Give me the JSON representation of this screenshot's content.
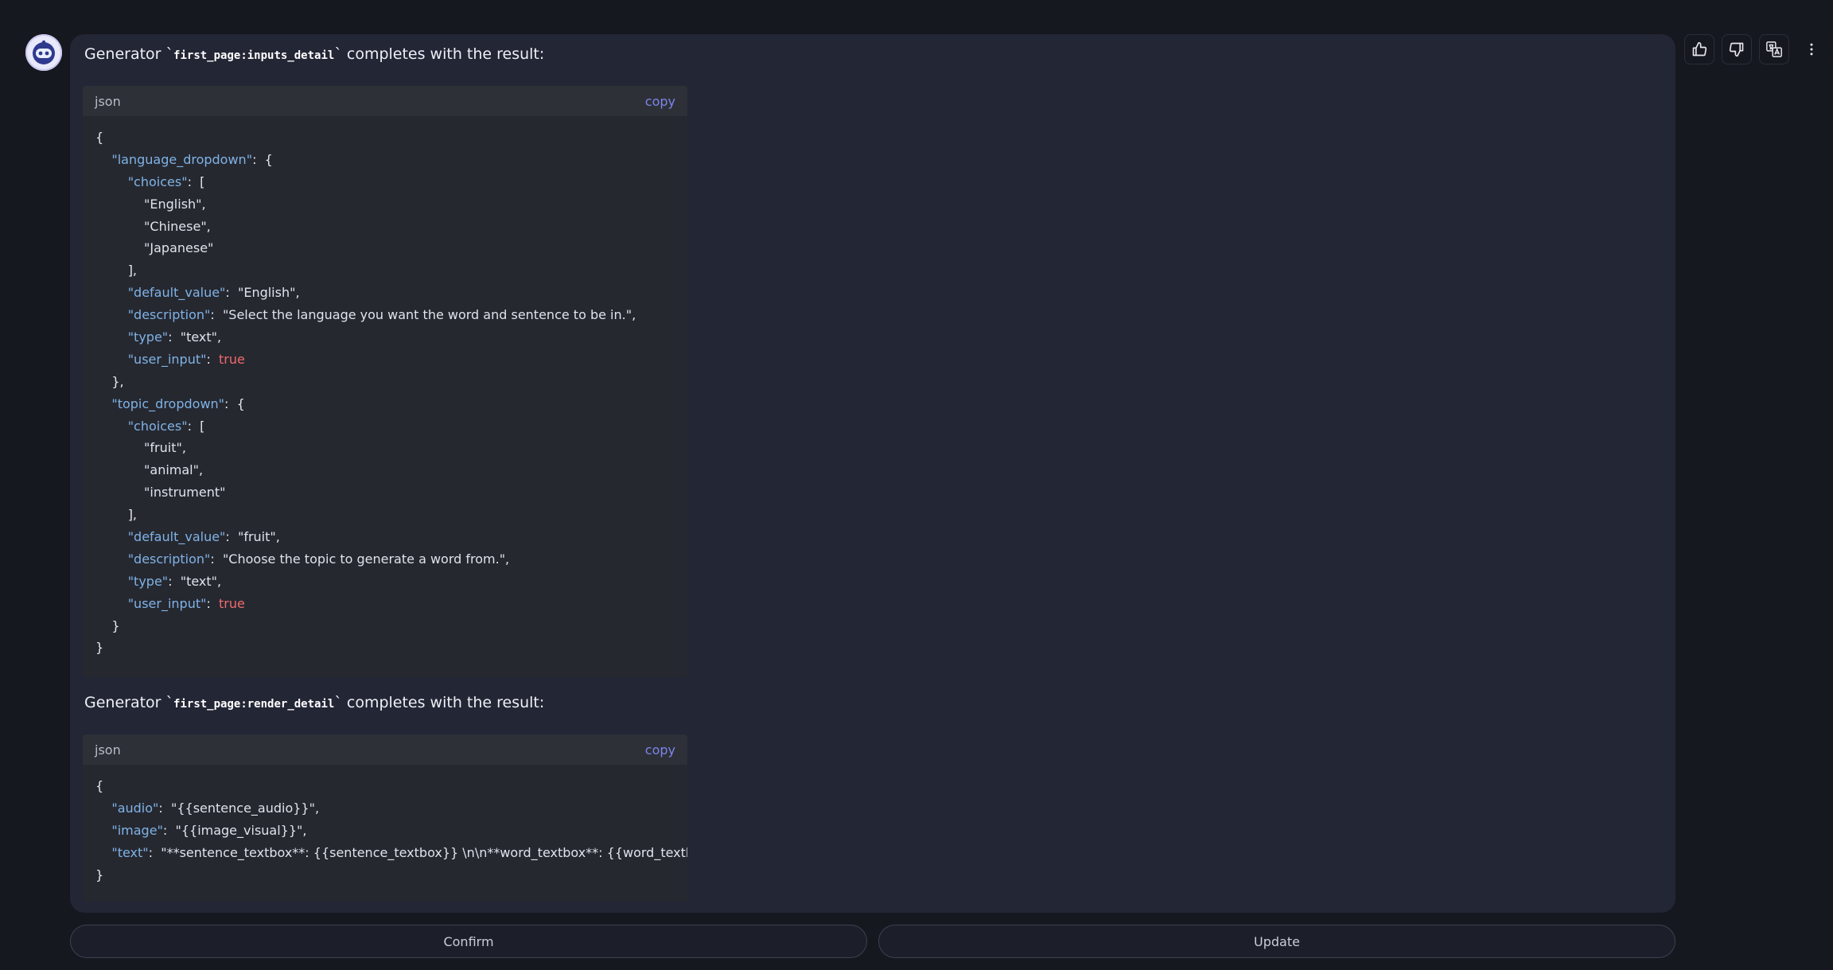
{
  "message_1": {
    "prefix": "Generator `",
    "generator": "first_page:inputs_detail",
    "suffix": "` completes with the result:"
  },
  "code_1": {
    "lang": "json",
    "copy_label": "copy",
    "lines": [
      [
        [
          "p",
          "{"
        ]
      ],
      [
        [
          "p",
          "    "
        ],
        [
          "k",
          "\"language_dropdown\""
        ],
        [
          "p",
          ":  {"
        ]
      ],
      [
        [
          "p",
          "        "
        ],
        [
          "k",
          "\"choices\""
        ],
        [
          "p",
          ":  ["
        ]
      ],
      [
        [
          "p",
          "            "
        ],
        [
          "s",
          "\"English\""
        ],
        [
          "p",
          ","
        ]
      ],
      [
        [
          "p",
          "            "
        ],
        [
          "s",
          "\"Chinese\""
        ],
        [
          "p",
          ","
        ]
      ],
      [
        [
          "p",
          "            "
        ],
        [
          "s",
          "\"Japanese\""
        ]
      ],
      [
        [
          "p",
          "        ],"
        ]
      ],
      [
        [
          "p",
          "        "
        ],
        [
          "k",
          "\"default_value\""
        ],
        [
          "p",
          ":  "
        ],
        [
          "s",
          "\"English\""
        ],
        [
          "p",
          ","
        ]
      ],
      [
        [
          "p",
          "        "
        ],
        [
          "k",
          "\"description\""
        ],
        [
          "p",
          ":  "
        ],
        [
          "s",
          "\"Select the language you want the word and sentence to be in.\""
        ],
        [
          "p",
          ","
        ]
      ],
      [
        [
          "p",
          "        "
        ],
        [
          "k",
          "\"type\""
        ],
        [
          "p",
          ":  "
        ],
        [
          "s",
          "\"text\""
        ],
        [
          "p",
          ","
        ]
      ],
      [
        [
          "p",
          "        "
        ],
        [
          "k",
          "\"user_input\""
        ],
        [
          "p",
          ":  "
        ],
        [
          "b",
          "true"
        ]
      ],
      [
        [
          "p",
          "    },"
        ]
      ],
      [
        [
          "p",
          "    "
        ],
        [
          "k",
          "\"topic_dropdown\""
        ],
        [
          "p",
          ":  {"
        ]
      ],
      [
        [
          "p",
          "        "
        ],
        [
          "k",
          "\"choices\""
        ],
        [
          "p",
          ":  ["
        ]
      ],
      [
        [
          "p",
          "            "
        ],
        [
          "s",
          "\"fruit\""
        ],
        [
          "p",
          ","
        ]
      ],
      [
        [
          "p",
          "            "
        ],
        [
          "s",
          "\"animal\""
        ],
        [
          "p",
          ","
        ]
      ],
      [
        [
          "p",
          "            "
        ],
        [
          "s",
          "\"instrument\""
        ]
      ],
      [
        [
          "p",
          "        ],"
        ]
      ],
      [
        [
          "p",
          "        "
        ],
        [
          "k",
          "\"default_value\""
        ],
        [
          "p",
          ":  "
        ],
        [
          "s",
          "\"fruit\""
        ],
        [
          "p",
          ","
        ]
      ],
      [
        [
          "p",
          "        "
        ],
        [
          "k",
          "\"description\""
        ],
        [
          "p",
          ":  "
        ],
        [
          "s",
          "\"Choose the topic to generate a word from.\""
        ],
        [
          "p",
          ","
        ]
      ],
      [
        [
          "p",
          "        "
        ],
        [
          "k",
          "\"type\""
        ],
        [
          "p",
          ":  "
        ],
        [
          "s",
          "\"text\""
        ],
        [
          "p",
          ","
        ]
      ],
      [
        [
          "p",
          "        "
        ],
        [
          "k",
          "\"user_input\""
        ],
        [
          "p",
          ":  "
        ],
        [
          "b",
          "true"
        ]
      ],
      [
        [
          "p",
          "    }"
        ]
      ],
      [
        [
          "p",
          "}"
        ]
      ]
    ]
  },
  "message_2": {
    "prefix": "Generator `",
    "generator": "first_page:render_detail",
    "suffix": "` completes with the result:"
  },
  "code_2": {
    "lang": "json",
    "copy_label": "copy",
    "lines": [
      [
        [
          "p",
          "{"
        ]
      ],
      [
        [
          "p",
          "    "
        ],
        [
          "k",
          "\"audio\""
        ],
        [
          "p",
          ":  "
        ],
        [
          "s",
          "\"{{sentence_audio}}\""
        ],
        [
          "p",
          ","
        ]
      ],
      [
        [
          "p",
          "    "
        ],
        [
          "k",
          "\"image\""
        ],
        [
          "p",
          ":  "
        ],
        [
          "s",
          "\"{{image_visual}}\""
        ],
        [
          "p",
          ","
        ]
      ],
      [
        [
          "p",
          "    "
        ],
        [
          "k",
          "\"text\""
        ],
        [
          "p",
          ":  "
        ],
        [
          "s",
          "\"**sentence_textbox**: {{sentence_textbox}} \\n\\n**word_textbox**: {{word_textbox}} \\n\\n\""
        ]
      ],
      [
        [
          "p",
          "}"
        ]
      ]
    ]
  },
  "actions": {
    "confirm_label": "Confirm",
    "update_label": "Update"
  },
  "toolbar_icons": [
    "thumbs-up-icon",
    "thumbs-down-icon",
    "translate-icon",
    "more-vertical-icon"
  ],
  "colors": {
    "background": "#16181f",
    "card": "#232635",
    "code_bg": "#262830",
    "json_key": "#7fb3e6",
    "json_bool": "#ef6b6b",
    "copy_link": "#7b86e8"
  }
}
